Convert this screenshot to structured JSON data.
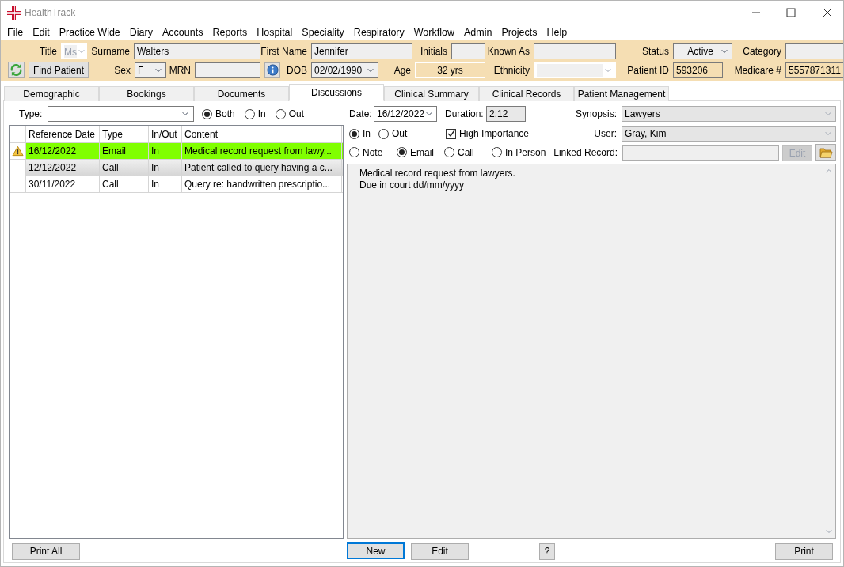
{
  "window": {
    "title": "HealthTrack"
  },
  "menu": [
    "File",
    "Edit",
    "Practice Wide",
    "Diary",
    "Accounts",
    "Reports",
    "Hospital",
    "Speciality",
    "Respiratory",
    "Workflow",
    "Admin",
    "Projects",
    "Help"
  ],
  "patient_header": {
    "row_1": [
      {
        "label": "Title",
        "value": "Ms",
        "kind": "select",
        "disabled": true
      },
      {
        "label": "Surname",
        "value": "Walters",
        "kind": "text"
      },
      {
        "label": "First Name",
        "value": "Jennifer",
        "kind": "text"
      },
      {
        "label": "Initials",
        "kind": "text"
      },
      {
        "label": "Known As",
        "kind": "text"
      },
      {
        "label": "Status",
        "value": "Active",
        "kind": "select",
        "disabled": false
      },
      {
        "label": "Category",
        "kind": "text"
      }
    ],
    "find_button": "Find Patient",
    "row_2": [
      {
        "label": "Sex",
        "value": "F",
        "kind": "select",
        "disabled": false
      },
      {
        "label": "MRN",
        "kind": "text"
      },
      {
        "kind": "info"
      },
      {
        "label": "DOB",
        "value": "02/02/1990",
        "kind": "date"
      },
      {
        "label": "Age",
        "value": "32 yrs",
        "kind": "readonly"
      },
      {
        "label": "Ethnicity",
        "kind": "select",
        "disabled": true
      },
      {
        "label": "Patient ID",
        "value": "593206",
        "kind": "readonly"
      },
      {
        "label": "Medicare #",
        "value": "5557871311",
        "kind": "readonly"
      }
    ]
  },
  "tabs": [
    {
      "label": "Demographic",
      "selected": false
    },
    {
      "label": "Bookings",
      "selected": false
    },
    {
      "label": "Documents",
      "selected": false
    },
    {
      "label": "Discussions",
      "selected": true
    },
    {
      "label": "Clinical Summary",
      "selected": false
    },
    {
      "label": "Clinical Records",
      "selected": false
    },
    {
      "label": "Patient Management",
      "selected": false
    }
  ],
  "filter": {
    "label": "Type:",
    "options": [
      {
        "label": "Both",
        "selected": true
      },
      {
        "label": "In",
        "selected": false
      },
      {
        "label": "Out",
        "selected": false
      }
    ]
  },
  "table": {
    "columns": [
      "Reference Date",
      "Type",
      "In/Out",
      "Content"
    ],
    "rows": [
      {
        "cells": [
          "16/12/2022",
          "Email",
          "In",
          "Medical record request from lawy..."
        ],
        "flagged": true,
        "selected": true,
        "shaded": false
      },
      {
        "cells": [
          "12/12/2022",
          "Call",
          "In",
          "Patient called to query having a c..."
        ],
        "flagged": false,
        "selected": false,
        "shaded": true
      },
      {
        "cells": [
          "30/11/2022",
          "Call",
          "In",
          "Query re: handwritten prescriptio..."
        ],
        "flagged": false,
        "selected": false,
        "shaded": false
      }
    ]
  },
  "detail": {
    "date": {
      "label": "Date:",
      "value": "16/12/2022"
    },
    "duration": {
      "label": "Duration:",
      "value": "2:12"
    },
    "synopsis": {
      "label": "Synopsis:",
      "value": "Lawyers"
    },
    "direction": [
      {
        "label": "In",
        "selected": true
      },
      {
        "label": "Out",
        "selected": false
      }
    ],
    "high_importance": {
      "label": "High Importance",
      "checked": true
    },
    "user": {
      "label": "User:",
      "value": "Gray, Kim"
    },
    "kinds": [
      {
        "label": "Note",
        "selected": false
      },
      {
        "label": "Email",
        "selected": true
      },
      {
        "label": "Call",
        "selected": false
      },
      {
        "label": "In Person",
        "selected": false
      }
    ],
    "linked_record": {
      "label": "Linked Record:",
      "edit_button": {
        "label": "Edit",
        "disabled": true
      }
    },
    "notes": [
      "Medical record request from lawyers.",
      "Due in court dd/mm/yyyy"
    ]
  },
  "print_all_button": "Print All",
  "buttons": [
    {
      "label": "New",
      "focused": true
    },
    {
      "label": "Edit",
      "focused": false
    },
    {
      "label": "?",
      "focused": false
    },
    {
      "label": "Print",
      "focused": false
    }
  ]
}
